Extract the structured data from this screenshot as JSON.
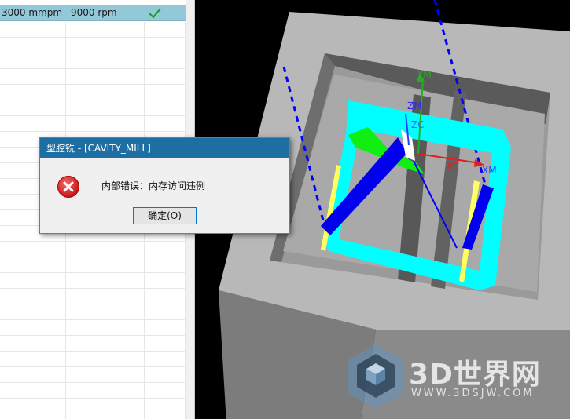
{
  "operation_list": {
    "selected_row": {
      "feed": "3000 mmpm",
      "speed": "9000 rpm",
      "status_icon": "checkmark-icon"
    },
    "empty_rows": 26
  },
  "dialog": {
    "title": "型腔铣 - [CAVITY_MILL]",
    "message": "内部错误：内存访问违例",
    "ok_label": "确定(O)",
    "icon": "error-icon"
  },
  "viewport": {
    "axis_labels": {
      "ym": "YM",
      "zm": "ZM",
      "zc": "ZC",
      "xc": "XC",
      "xm": "XM"
    },
    "colors": {
      "stock_top": "#b8b8b8",
      "stock_side": "#8a8a8a",
      "toolpath": "#00ffff",
      "tool_axis": "#0000ff",
      "x_axis": "#e02020",
      "y_axis": "#20b020"
    }
  },
  "watermark": {
    "brand": "3D世界网",
    "url": "WWW.3DSJW.COM"
  }
}
